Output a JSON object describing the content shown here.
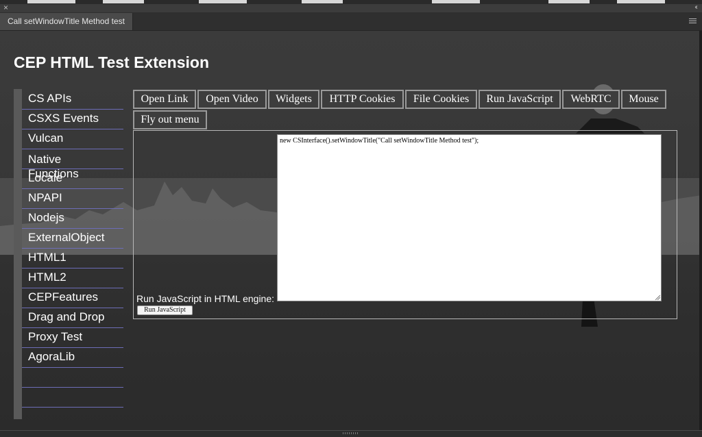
{
  "window": {
    "tab_title": "Call setWindowTitle Method test"
  },
  "extension": {
    "title": "CEP HTML Test Extension"
  },
  "sidebar": {
    "items": [
      {
        "label": "CS APIs"
      },
      {
        "label": "CSXS Events"
      },
      {
        "label": "Vulcan"
      },
      {
        "label": "Native Functions"
      },
      {
        "label": "Locale"
      },
      {
        "label": "NPAPI"
      },
      {
        "label": "Nodejs"
      },
      {
        "label": "ExternalObject"
      },
      {
        "label": "HTML1"
      },
      {
        "label": "HTML2"
      },
      {
        "label": "CEPFeatures"
      },
      {
        "label": "Drag and Drop"
      },
      {
        "label": "Proxy Test"
      },
      {
        "label": "AgoraLib"
      }
    ]
  },
  "tabs": [
    {
      "label": "Open Link"
    },
    {
      "label": "Open Video"
    },
    {
      "label": "Widgets"
    },
    {
      "label": "HTTP Cookies"
    },
    {
      "label": "File Cookies"
    },
    {
      "label": "Run JavaScript"
    },
    {
      "label": "WebRTC"
    },
    {
      "label": "Mouse"
    },
    {
      "label": "Fly out menu"
    }
  ],
  "run_js": {
    "code": "new CSInterface().setWindowTitle(\"Call setWindowTitle Method test\");",
    "label": "Run JavaScript in HTML engine:",
    "button": "Run JavaScript"
  },
  "colors": {
    "sidebar_underline": "#6d6db8",
    "background": "#3a3a3a"
  }
}
